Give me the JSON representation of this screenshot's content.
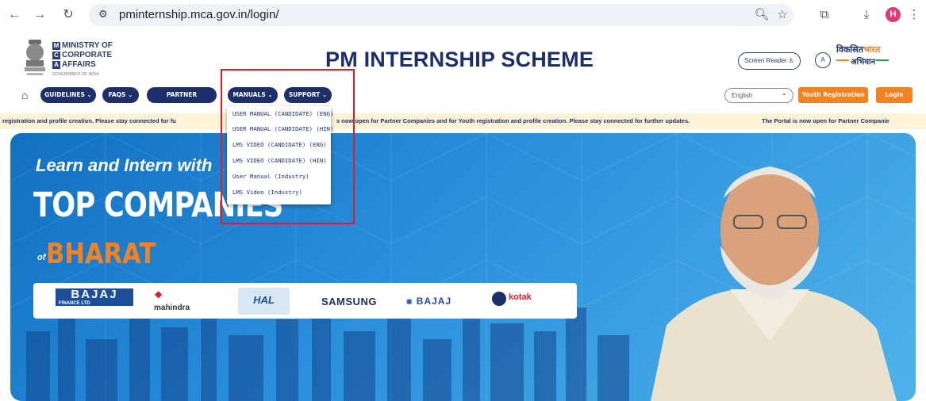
{
  "browser": {
    "url": "pminternship.mca.gov.in/login/",
    "avatar_letter": "H"
  },
  "header": {
    "ministry_line1": "MINISTRY OF",
    "ministry_line2": "CORPORATE",
    "ministry_line3": "AFFAIRS",
    "government": "GOVERNMENT OF INDIA",
    "title": "PM INTERNSHIP SCHEME",
    "screen_reader": "Screen Reader",
    "font_size_toggle": "A",
    "viksit_line1": "विकसित",
    "viksit_line2": "भारत",
    "viksit_line3": "अभियान"
  },
  "nav": {
    "guidelines": "GUIDELINES",
    "faqs": "FAQS",
    "partner_companies": "PARTNER COMPANIES",
    "manuals": "MANUALS",
    "support": "SUPPORT",
    "language": "English",
    "youth_registration": "Youth Registration",
    "login": "Login"
  },
  "manuals_menu": {
    "items": [
      "USER MANUAL (CANDIDATE) (ENG)",
      "USER MANUAL (CANDIDATE) (HIN)",
      "LMS VIDEO (CANDIDATE) (ENG)",
      "LMS VIDEO (CANDIDATE) (HIN)",
      "User Manual (Industry)",
      "LMS Video (Industry)"
    ]
  },
  "ticker": {
    "seg1": "registration and profile creation. Please stay connected for fu",
    "seg2": "s now open for Partner Companies and for Youth registration and profile creation. Please stay connected for further updates.",
    "seg3": "The Portal is now open for Partner Companie"
  },
  "hero": {
    "learn": "Learn and Intern with",
    "top": "TOP COMPANIES",
    "of": "of",
    "bharat": "BHARAT"
  },
  "logos": {
    "bajaj_finance": "BAJAJ",
    "bajaj_finance_sub": "FINANCE LTD",
    "mahindra": "mahindra",
    "hal": "HAL",
    "samsung": "SAMSUNG",
    "bajaj": "BAJAJ",
    "kotak": "kotak"
  },
  "colors": {
    "navy": "#1d2f6b",
    "orange": "#f58220",
    "highlight_red": "#e31b23",
    "ticker_bg": "#fdf3d6"
  }
}
